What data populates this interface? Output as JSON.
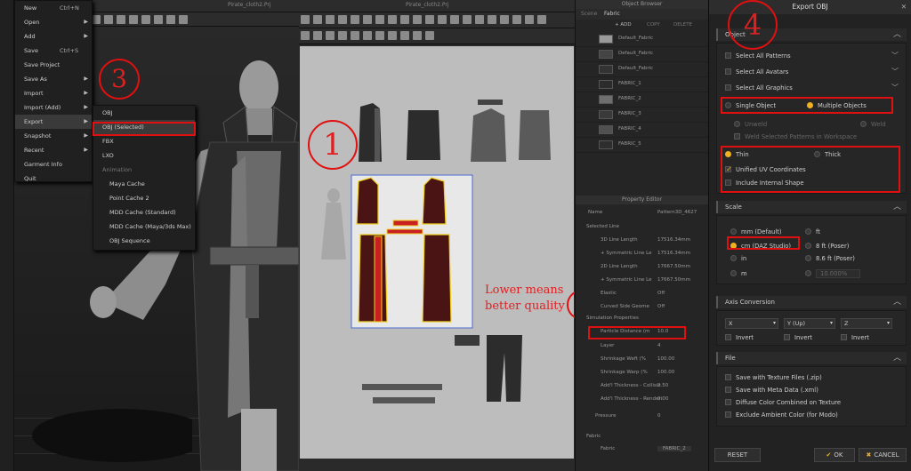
{
  "file_menu": {
    "items": [
      {
        "label": "New",
        "shortcut": "Ctrl+N",
        "arrow": false
      },
      {
        "label": "Open",
        "shortcut": "",
        "arrow": true
      },
      {
        "label": "Add",
        "shortcut": "",
        "arrow": true
      },
      {
        "label": "Save",
        "shortcut": "Ctrl+S",
        "arrow": false
      },
      {
        "label": "Save Project",
        "shortcut": "",
        "arrow": false
      },
      {
        "label": "Save As",
        "shortcut": "",
        "arrow": true
      },
      {
        "label": "Import",
        "shortcut": "",
        "arrow": true
      },
      {
        "label": "Import (Add)",
        "shortcut": "",
        "arrow": true
      },
      {
        "label": "Export",
        "shortcut": "",
        "arrow": true
      },
      {
        "label": "Snapshot",
        "shortcut": "",
        "arrow": true
      },
      {
        "label": "Recent",
        "shortcut": "",
        "arrow": true
      },
      {
        "label": "Garment Info",
        "shortcut": "",
        "arrow": false
      },
      {
        "label": "Quit",
        "shortcut": "",
        "arrow": false
      }
    ]
  },
  "export_menu": {
    "items": [
      "OBJ",
      "OBJ (Selected)",
      "FBX",
      "LXO",
      "Animation",
      "Maya Cache",
      "Point Cache 2",
      "MDD Cache (Standard)",
      "MDD Cache (Maya/3ds Max)",
      "OBJ Sequence"
    ]
  },
  "windows": {
    "view3d_title": "Pirate_cloth2.Prj",
    "pattern_title": "Pirate_cloth2.Prj"
  },
  "object_browser": {
    "title": "Object Browser",
    "tabs": [
      "Scene",
      "Fabric"
    ],
    "add_label": "+ ADD",
    "copy_label": "COPY",
    "delete_label": "DELETE",
    "fabrics": [
      {
        "name": "Default_Fabric",
        "color": "#9a9a9a"
      },
      {
        "name": "Default_Fabric",
        "color": "#444444"
      },
      {
        "name": "Default_Fabric",
        "color": "#333333"
      },
      {
        "name": "FABRIC_1",
        "color": "#2c2c2c"
      },
      {
        "name": "FABRIC_2",
        "color": "#6e6e6e"
      },
      {
        "name": "FABRIC_3",
        "color": "#3a3a3a"
      },
      {
        "name": "FABRIC_4",
        "color": "#505050"
      },
      {
        "name": "FABRIC_5",
        "color": "#2e2e2e"
      }
    ]
  },
  "property_editor": {
    "title": "Property Editor",
    "name_label": "Name",
    "name_value": "Pattern3D_4627",
    "selected_line": "Selected Line",
    "rows": [
      {
        "label": "3D Line Length",
        "value": "17516.34mm"
      },
      {
        "label": "+ Symmetric Line Le",
        "value": "17516.34mm"
      },
      {
        "label": "2D Line Length",
        "value": "17667.50mm"
      },
      {
        "label": "+ Symmetric Line Le",
        "value": "17667.50mm"
      },
      {
        "label": "Elastic",
        "value": "Off"
      },
      {
        "label": "Curved Side Geome",
        "value": "Off"
      }
    ],
    "sim_props": "Simulation Properties",
    "particle_label": "Particle Distance (m",
    "particle_value": "10.0",
    "rows2": [
      {
        "label": "Layer",
        "value": "4"
      },
      {
        "label": "Shrinkage Weft (%",
        "value": "100.00"
      },
      {
        "label": "Shrinkage Warp (%",
        "value": "100.00"
      },
      {
        "label": "Add'l Thickness - Collisio",
        "value": "2.50"
      },
      {
        "label": "Add'l Thickness - Renderi",
        "value": "0.00"
      }
    ],
    "pressure_label": "Pressure",
    "pressure_value": "0",
    "fabric_head": "Fabric",
    "fabric_label": "Fabric",
    "fabric_value": "FABRIC_2"
  },
  "annotations": {
    "n1": "1",
    "n2": "2",
    "n3": "3",
    "n4": "4",
    "note_line1": "Lower  means",
    "note_line2": "better quality"
  },
  "dialog": {
    "title": "Export OBJ",
    "object_section": "Object",
    "select_all_patterns": "Select All Patterns",
    "select_all_avatars": "Select All Avatars",
    "select_all_graphics": "Select All Graphics",
    "single_object": "Single Object",
    "multiple_objects": "Multiple Objects",
    "unweld": "Unweld",
    "weld": "Weld",
    "weld_selected": "Weld Selected Patterns in Workspace",
    "thin": "Thin",
    "thick": "Thick",
    "unified_uv": "Unified UV Coordinates",
    "include_internal": "Include Internal Shape",
    "scale_section": "Scale",
    "scale_mm": "mm (Default)",
    "scale_cm": "cm (DAZ Studio)",
    "scale_in": "in",
    "scale_m": "m",
    "scale_ft": "ft",
    "scale_8ft": "8 ft (Poser)",
    "scale_86ft": "8.6 ft (Poser)",
    "scale_custom": "10.000%",
    "axis_section": "Axis Conversion",
    "axis_x": "X",
    "axis_y": "Y (Up)",
    "axis_z": "Z",
    "invert": "Invert",
    "file_section": "File",
    "save_texture": "Save with Texture Files (.zip)",
    "save_meta": "Save with Meta Data (.xml)",
    "diffuse": "Diffuse Color Combined on Texture",
    "exclude_ambient": "Exclude Ambient Color (for Modo)",
    "reset": "RESET",
    "ok": "OK",
    "cancel": "CANCEL"
  },
  "colors": {
    "accent": "#f0b020",
    "annotation": "#e01010",
    "pattern_fill": "#4a1414"
  }
}
